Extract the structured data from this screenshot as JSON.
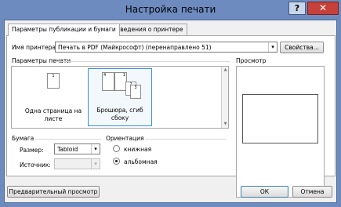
{
  "window": {
    "title": "Настройка печати",
    "help_label": "?",
    "close_label": "✕"
  },
  "tabs": [
    {
      "label": "Параметры публикации и бумаги",
      "active": true
    },
    {
      "label": "Сведения о принтере",
      "active": false
    }
  ],
  "printer": {
    "label": "Имя принтера:",
    "value": "Печать в PDF (Майкрософт) (перенаправлено 51)",
    "properties_label": "Свойства..."
  },
  "print_options": {
    "label": "Параметры печати",
    "items": [
      {
        "label": "Одна страница на листе",
        "page_number": "1",
        "selected": false
      },
      {
        "label": "Брошюра, сгиб сбоку",
        "page_numbers": [
          "4",
          "1",
          "2",
          "3"
        ],
        "selected": true
      }
    ]
  },
  "preview": {
    "label": "Просмотр"
  },
  "paper": {
    "label": "Бумага",
    "size_label": "Размер:",
    "size_value": "Tabloid",
    "source_label": "Источник:",
    "source_value": ""
  },
  "orientation": {
    "label": "Ориентация",
    "options": [
      {
        "label": "книжная",
        "checked": false
      },
      {
        "label": "альбомная",
        "checked": true
      }
    ]
  },
  "footer": {
    "preview_button": "Предварительный просмотр",
    "ok_button": "ОК",
    "cancel_button": "Отмена"
  },
  "icons": {
    "dropdown": "▾",
    "scroll_up": "▲",
    "scroll_down": "▼"
  }
}
